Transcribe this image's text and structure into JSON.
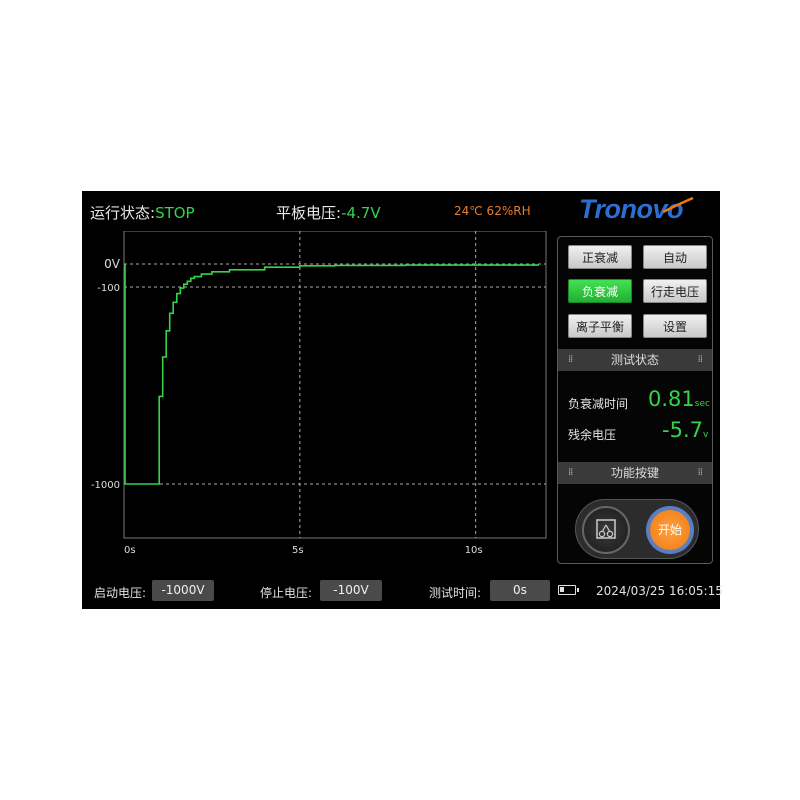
{
  "header": {
    "status_label": "运行状态:",
    "status_value": "STOP",
    "plate_label": "平板电压:",
    "plate_value": "-4.7V",
    "environment": "24℃ 62%RH",
    "brand": "Tronovo"
  },
  "chart_data": {
    "type": "line",
    "y_tick_labels": [
      "0V",
      "-100",
      "-1000"
    ],
    "x_tick_labels": [
      "0s",
      "5s",
      "10s"
    ],
    "xlim": [
      0,
      12
    ],
    "ylim": [
      -1000,
      0
    ],
    "series": [
      {
        "color": "#35d24a",
        "x": [
          0,
          0.9,
          1.0,
          1.1,
          1.2,
          1.3,
          1.4,
          1.5,
          1.6,
          1.7,
          1.8,
          1.9,
          2.0,
          2.2,
          2.5,
          3.0,
          4.0,
          5.0,
          6.0,
          8.0,
          10.0,
          11.8
        ],
        "y": [
          -1000,
          -1000,
          -600,
          -420,
          -300,
          -220,
          -170,
          -130,
          -105,
          -88,
          -75,
          -62,
          -55,
          -44,
          -34,
          -25,
          -14,
          -8,
          -6,
          -5,
          -5,
          -5
        ]
      }
    ],
    "colors": {
      "background": "#000000",
      "grid": "#aaaaaa",
      "axis": "#cccccc",
      "line": "#35d24a"
    }
  },
  "buttons": {
    "positive_decay": "正衰减",
    "auto": "自动",
    "negative_decay": "负衰减",
    "walking_voltage": "行走电压",
    "ion_balance": "离子平衡",
    "settings": "设置"
  },
  "test_status": {
    "title": "测试状态",
    "decay_time_label": "负衰减时间",
    "decay_time_value": "0.81",
    "decay_time_unit": "sec",
    "residual_label": "残余电压",
    "residual_value": "-5.7",
    "residual_unit": "v"
  },
  "function_keys": {
    "title": "功能按键",
    "start_label": "开始",
    "left_icon": "fan-icon"
  },
  "bottom": {
    "start_voltage_label": "启动电压:",
    "start_voltage_value": "-1000V",
    "stop_voltage_label": "停止电压:",
    "stop_voltage_value": "-100V",
    "test_time_label": "测试时间:",
    "test_time_value": "0s",
    "datetime": "2024/03/25 16:05:15"
  },
  "colors": {
    "accent": "#35d24a",
    "orange": "#f07a10",
    "brand_blue": "#2a6fd1"
  }
}
